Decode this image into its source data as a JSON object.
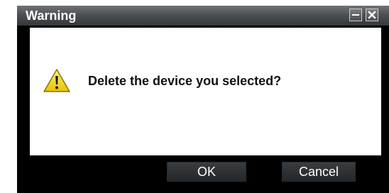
{
  "window": {
    "title": "Warning",
    "minimize_icon": "minimize-icon",
    "close_icon": "close-icon"
  },
  "body": {
    "icon": "warning-triangle-icon",
    "message": "Delete the device you selected?"
  },
  "buttons": {
    "ok_label": "OK",
    "cancel_label": "Cancel"
  },
  "colors": {
    "frame": "#000000",
    "titlebar": "#4d5054",
    "content_bg": "#ffffff",
    "warning_fill": "#f2d21c",
    "button_bg": "#2d3033"
  }
}
